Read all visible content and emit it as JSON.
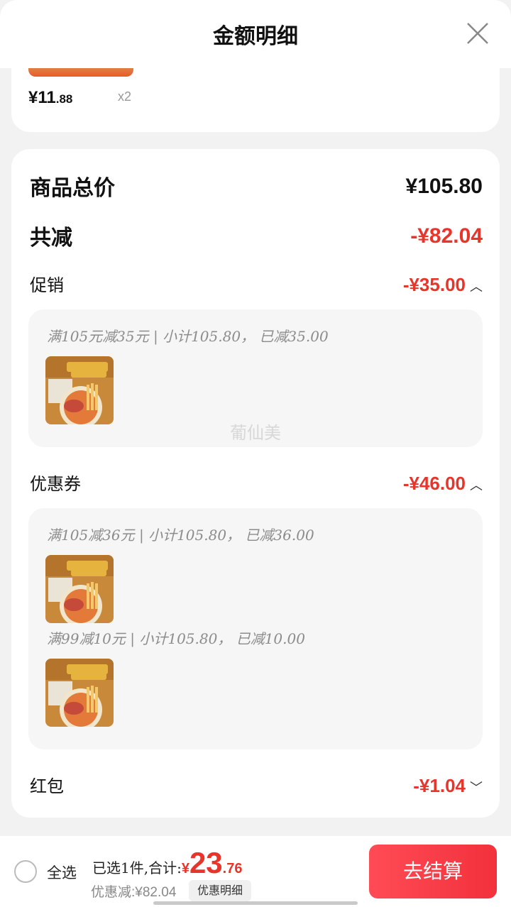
{
  "header": {
    "title": "金额明细"
  },
  "top_item": {
    "price_main": "¥11",
    "price_decimal": ".88",
    "quantity": "x2"
  },
  "summary": {
    "total_label": "商品总价",
    "total_value": "¥105.80",
    "reduce_label": "共减",
    "reduce_value": "-¥82.04"
  },
  "promotion": {
    "label": "促销",
    "value": "-¥35.00",
    "rules": [
      {
        "text": "满105元减35元 | 小计105.80， 已减35.00"
      }
    ]
  },
  "watermark": "葡仙美",
  "coupon": {
    "label": "优惠券",
    "value": "-¥46.00",
    "rules": [
      {
        "text": "满105减36元 | 小计105.80， 已减36.00"
      },
      {
        "text": "满99减10元 | 小计105.80， 已减10.00"
      }
    ]
  },
  "red_packet": {
    "label": "红包",
    "value": "-¥1.04"
  },
  "footer": {
    "select_all": "全选",
    "selected_text": "已选1件,合计:",
    "currency": "¥",
    "total_int": "23",
    "total_dec": ".76",
    "discount_text": "优惠减:¥82.04",
    "detail_chip": "优惠明细",
    "checkout": "去结算"
  },
  "colors": {
    "accent_red": "#e8352b",
    "button_red": "#f2313c"
  },
  "icons": {
    "close": "close-icon",
    "chevron_up": "chevron-up-icon",
    "chevron_down": "chevron-down-icon"
  }
}
